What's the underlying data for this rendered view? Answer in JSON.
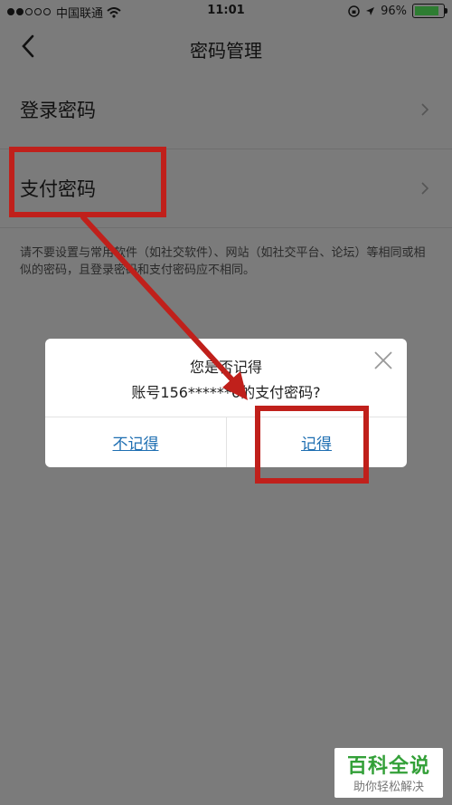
{
  "status_bar": {
    "carrier": "中国联通",
    "time": "11:01",
    "battery": "96%"
  },
  "nav": {
    "title": "密码管理"
  },
  "list": [
    {
      "label": "登录密码"
    },
    {
      "label": "支付密码"
    }
  ],
  "hint": "请不要设置与常用软件（如社交软件）、网站（如社交平台、论坛）等相同或相似的密码，且登录密码和支付密码应不相同。",
  "dialog": {
    "line1": "您是否记得",
    "line2": "账号156******6的支付密码?",
    "cancel": "不记得",
    "confirm": "记得"
  },
  "watermark": {
    "brand": "百科全说",
    "slogan": "助你轻松解决"
  },
  "colors": {
    "annotation": "#c0201b",
    "link": "#1f6fb2",
    "brand_green": "#33a038"
  }
}
